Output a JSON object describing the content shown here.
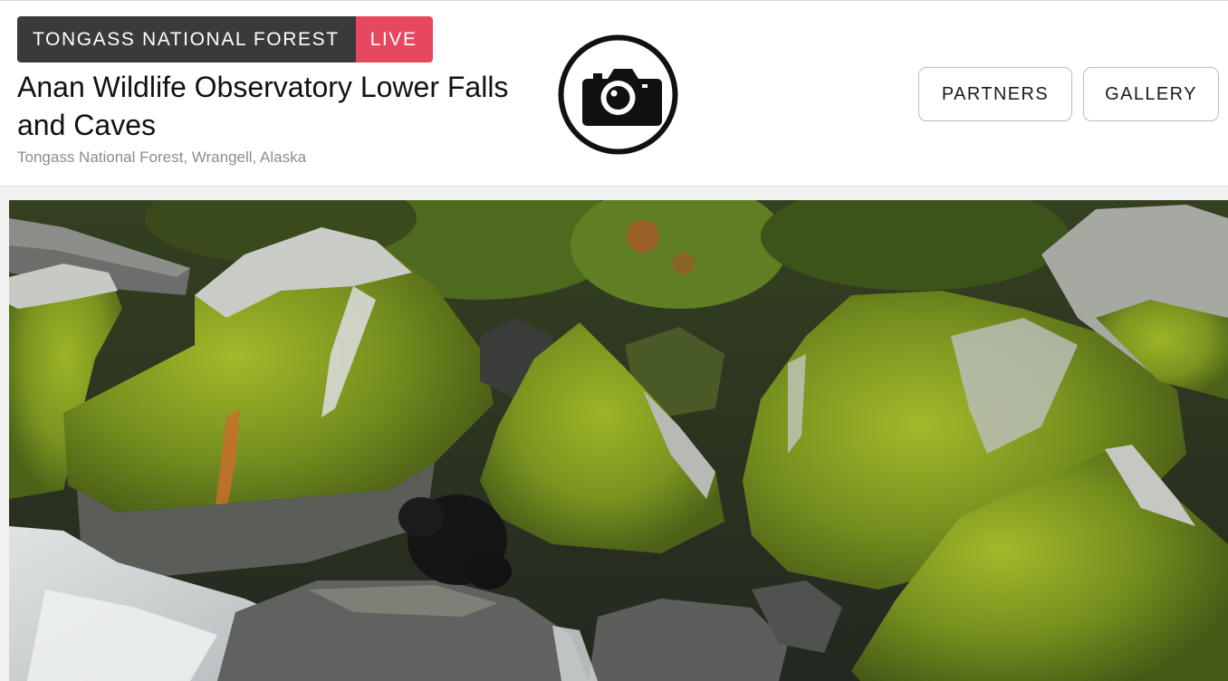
{
  "header": {
    "forest_badge": "TONGASS NATIONAL FOREST",
    "live_badge": "LIVE",
    "title": "Anan Wildlife Observatory Lower Falls and Caves",
    "location": "Tongass National Forest, Wrangell, Alaska",
    "logo_icon": "camera-icon"
  },
  "nav": {
    "partners_label": "PARTNERS",
    "gallery_label": "GALLERY"
  },
  "colors": {
    "badge_dark": "#3a3a3a",
    "live_red": "#e5485f",
    "moss_green": "#7d9a1f",
    "rock_gray": "#8a8d88"
  }
}
